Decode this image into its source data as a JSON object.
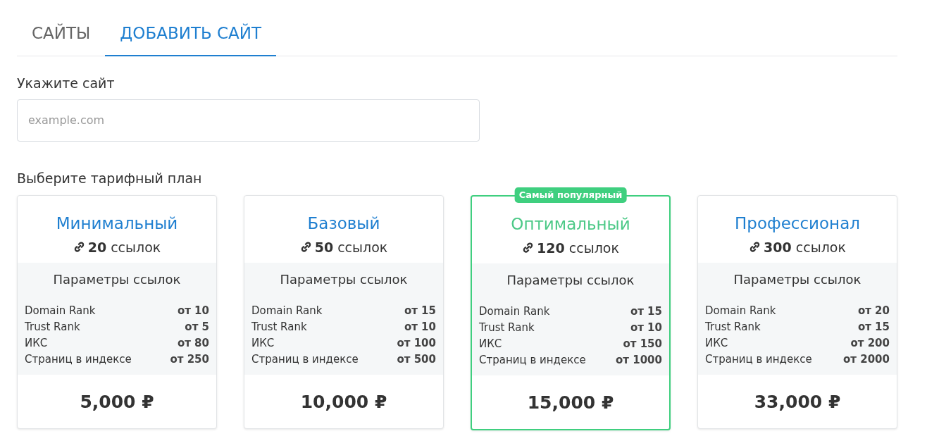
{
  "tabs": [
    {
      "label": "САЙТЫ",
      "selected": false
    },
    {
      "label": "ДОБАВИТЬ САЙТ",
      "selected": true
    }
  ],
  "site_field": {
    "label": "Укажите сайт",
    "placeholder": "example.com"
  },
  "plans_heading": "Выберите тарифный план",
  "plans": [
    {
      "name": "Минимальный",
      "featured": false,
      "links": "**20** ссылок",
      "params_title": "Параметры ссылок",
      "params": [
        {
          "label": "Domain Rank",
          "value": "от 10"
        },
        {
          "label": "Trust Rank",
          "value": "от 5"
        },
        {
          "label": "ИКС",
          "value": "от 80"
        },
        {
          "label": "Страниц в индексе",
          "value": "от 250"
        }
      ],
      "price": "5,000 ₽"
    },
    {
      "name": "Базовый",
      "featured": false,
      "links": "**50** ссылок",
      "params_title": "Параметры ссылок",
      "params": [
        {
          "label": "Domain Rank",
          "value": "от 15"
        },
        {
          "label": "Trust Rank",
          "value": "от 10"
        },
        {
          "label": "ИКС",
          "value": "от 100"
        },
        {
          "label": "Страниц в индексе",
          "value": "от 500"
        }
      ],
      "price": "10,000 ₽"
    },
    {
      "name": "Оптимальный",
      "featured": true,
      "badge": "Самый популярный",
      "links": "**120** ссылок",
      "params_title": "Параметры ссылок",
      "params": [
        {
          "label": "Domain Rank",
          "value": "от 15"
        },
        {
          "label": "Trust Rank",
          "value": "от 10"
        },
        {
          "label": "ИКС",
          "value": "от 150"
        },
        {
          "label": "Страниц в индексе",
          "value": "от 1000"
        }
      ],
      "price": "15,000 ₽"
    },
    {
      "name": "Профессионал",
      "featured": false,
      "links": "**300** ссылок",
      "params_title": "Параметры ссылок",
      "params": [
        {
          "label": "Domain Rank",
          "value": "от 20"
        },
        {
          "label": "Trust Rank",
          "value": "от 15"
        },
        {
          "label": "ИКС",
          "value": "от 200"
        },
        {
          "label": "Страниц в индексе",
          "value": "от 2000"
        }
      ],
      "price": "33,000 ₽"
    }
  ]
}
